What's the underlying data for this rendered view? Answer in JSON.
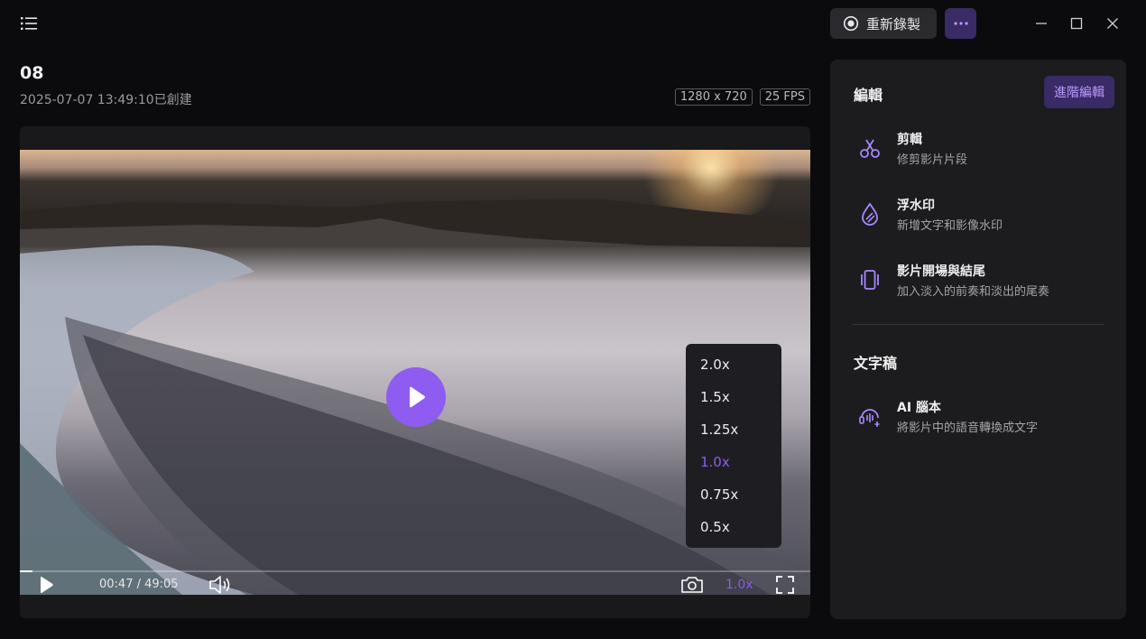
{
  "window": {
    "record_label": "重新錄製",
    "more_label": "···"
  },
  "video": {
    "title": "08",
    "created": "2025-07-07 13:49:10已創建",
    "resolution": "1280 x 720",
    "fps": "25 FPS"
  },
  "player": {
    "current_time": "00:47",
    "total_time": "49:05",
    "time_display": "00:47 / 49:05",
    "progress": 0.016,
    "speed_label": "1.0x",
    "speed_options": [
      "2.0x",
      "1.5x",
      "1.25x",
      "1.0x",
      "0.75x",
      "0.5x"
    ],
    "selected_speed": "1.0x"
  },
  "panel": {
    "edit_heading": "編輯",
    "advanced_edit_label": "進階編輯",
    "tools": [
      {
        "name": "剪輯",
        "desc": "修剪影片片段",
        "icon": "scissors-icon"
      },
      {
        "name": "浮水印",
        "desc": "新增文字和影像水印",
        "icon": "watermark-drop-icon"
      },
      {
        "name": "影片開場與結尾",
        "desc": "加入淡入的前奏和淡出的尾奏",
        "icon": "intro-outro-icon"
      }
    ],
    "transcript_heading": "文字稿",
    "transcript_tools": [
      {
        "name": "AI 腦本",
        "desc": "將影片中的語音轉換成文字",
        "icon": "ai-transcript-icon"
      }
    ]
  },
  "colors": {
    "accent": "#8e5cf0",
    "accent_bg": "#3a2a66",
    "panel_bg": "#1c1c1f",
    "window_bg": "#0b0b0d"
  }
}
